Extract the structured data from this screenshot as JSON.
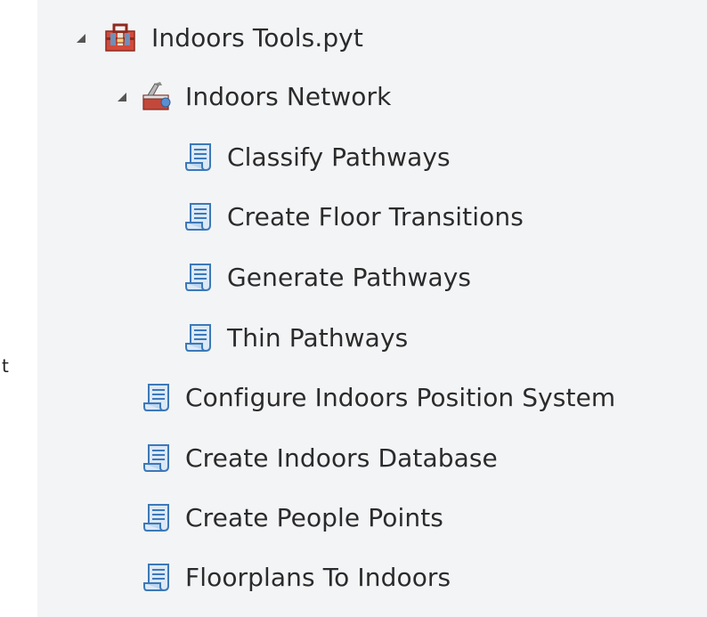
{
  "edge_fragment": "t",
  "tree": {
    "toolbox": {
      "label": "Indoors Tools.pyt",
      "icon": "toolbox-icon",
      "expanded": true
    },
    "toolset": {
      "label": "Indoors Network",
      "icon": "toolset-icon",
      "expanded": true,
      "tools": [
        {
          "label": "Classify Pathways",
          "icon": "script-tool-icon"
        },
        {
          "label": "Create Floor Transitions",
          "icon": "script-tool-icon"
        },
        {
          "label": "Generate Pathways",
          "icon": "script-tool-icon"
        },
        {
          "label": "Thin Pathways",
          "icon": "script-tool-icon"
        }
      ]
    },
    "tools": [
      {
        "label": "Configure Indoors Position System",
        "icon": "script-tool-icon"
      },
      {
        "label": "Create Indoors Database",
        "icon": "script-tool-icon"
      },
      {
        "label": "Create People Points",
        "icon": "script-tool-icon"
      },
      {
        "label": "Floorplans To Indoors",
        "icon": "script-tool-icon"
      }
    ]
  },
  "colors": {
    "panel_background": "#f3f4f6",
    "text": "#2b2b2b",
    "script_icon_blue": "#4a8fd0",
    "toolbox_red": "#c0392b"
  }
}
